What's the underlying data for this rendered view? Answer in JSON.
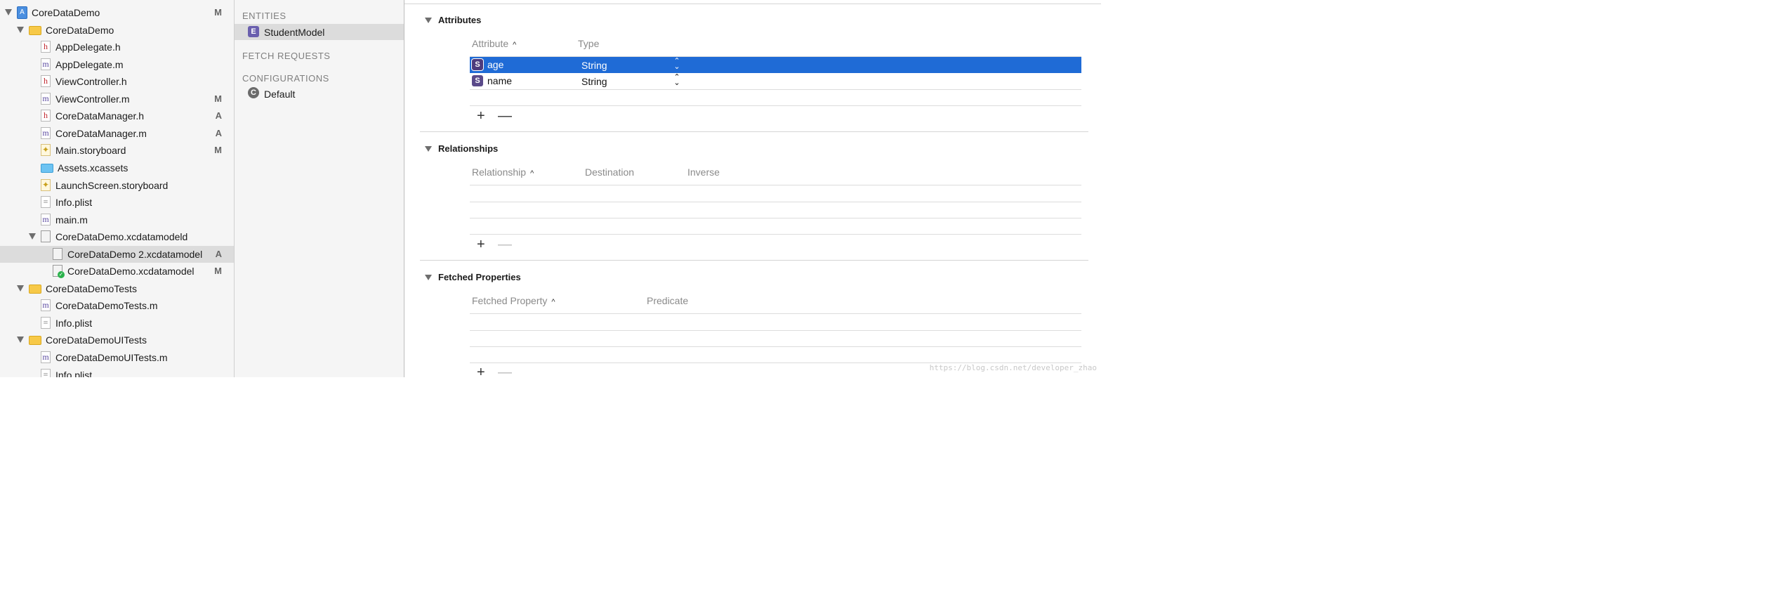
{
  "navigator": {
    "items": [
      {
        "label": "CoreDataDemo",
        "badge": "M",
        "kind": "project"
      },
      {
        "label": "CoreDataDemo",
        "badge": "",
        "kind": "folder"
      },
      {
        "label": "AppDelegate.h",
        "badge": "",
        "kind": "h",
        "glyph": "h"
      },
      {
        "label": "AppDelegate.m",
        "badge": "",
        "kind": "m",
        "glyph": "m"
      },
      {
        "label": "ViewController.h",
        "badge": "",
        "kind": "h",
        "glyph": "h"
      },
      {
        "label": "ViewController.m",
        "badge": "M",
        "kind": "m",
        "glyph": "m"
      },
      {
        "label": "CoreDataManager.h",
        "badge": "A",
        "kind": "h",
        "glyph": "h"
      },
      {
        "label": "CoreDataManager.m",
        "badge": "A",
        "kind": "m",
        "glyph": "m"
      },
      {
        "label": "Main.storyboard",
        "badge": "M",
        "kind": "storyboard"
      },
      {
        "label": "Assets.xcassets",
        "badge": "",
        "kind": "assets"
      },
      {
        "label": "LaunchScreen.storyboard",
        "badge": "",
        "kind": "storyboard"
      },
      {
        "label": "Info.plist",
        "badge": "",
        "kind": "plist"
      },
      {
        "label": "main.m",
        "badge": "",
        "kind": "m",
        "glyph": "m"
      },
      {
        "label": "CoreDataDemo.xcdatamodeld",
        "badge": "",
        "kind": "datamodeld"
      },
      {
        "label": "CoreDataDemo 2.xcdatamodel",
        "badge": "A",
        "kind": "datamodel",
        "selected": true
      },
      {
        "label": "CoreDataDemo.xcdatamodel",
        "badge": "M",
        "kind": "datamodel-current"
      },
      {
        "label": "CoreDataDemoTests",
        "badge": "",
        "kind": "folder"
      },
      {
        "label": "CoreDataDemoTests.m",
        "badge": "",
        "kind": "m",
        "glyph": "m"
      },
      {
        "label": "Info.plist",
        "badge": "",
        "kind": "plist"
      },
      {
        "label": "CoreDataDemoUITests",
        "badge": "",
        "kind": "folder"
      },
      {
        "label": "CoreDataDemoUITests.m",
        "badge": "",
        "kind": "m",
        "glyph": "m"
      },
      {
        "label": "Info.plist",
        "badge": "",
        "kind": "plist"
      }
    ]
  },
  "entity_pane": {
    "entities_header": "ENTITIES",
    "entity": {
      "badge": "E",
      "label": "StudentModel"
    },
    "fetch_header": "FETCH REQUESTS",
    "config_header": "CONFIGURATIONS",
    "configuration": {
      "badge": "C",
      "label": "Default"
    }
  },
  "attributes": {
    "title": "Attributes",
    "col_attribute": "Attribute",
    "col_type": "Type",
    "rows": [
      {
        "badge": "S",
        "name": "age",
        "type": "String",
        "selected": true
      },
      {
        "badge": "S",
        "name": "name",
        "type": "String",
        "selected": false
      }
    ]
  },
  "relationships": {
    "title": "Relationships",
    "col_relationship": "Relationship",
    "col_destination": "Destination",
    "col_inverse": "Inverse"
  },
  "fetched": {
    "title": "Fetched Properties",
    "col_property": "Fetched Property",
    "col_predicate": "Predicate"
  },
  "controls": {
    "add": "+",
    "remove": "—",
    "sort": "^",
    "stepper": "⌃⌄"
  },
  "watermark": "https://blog.csdn.net/developer_zhao",
  "colors": {
    "selection_blue": "#1f6bd6",
    "entity_purple": "#6a5fae",
    "folder_yellow": "#f7c948"
  }
}
